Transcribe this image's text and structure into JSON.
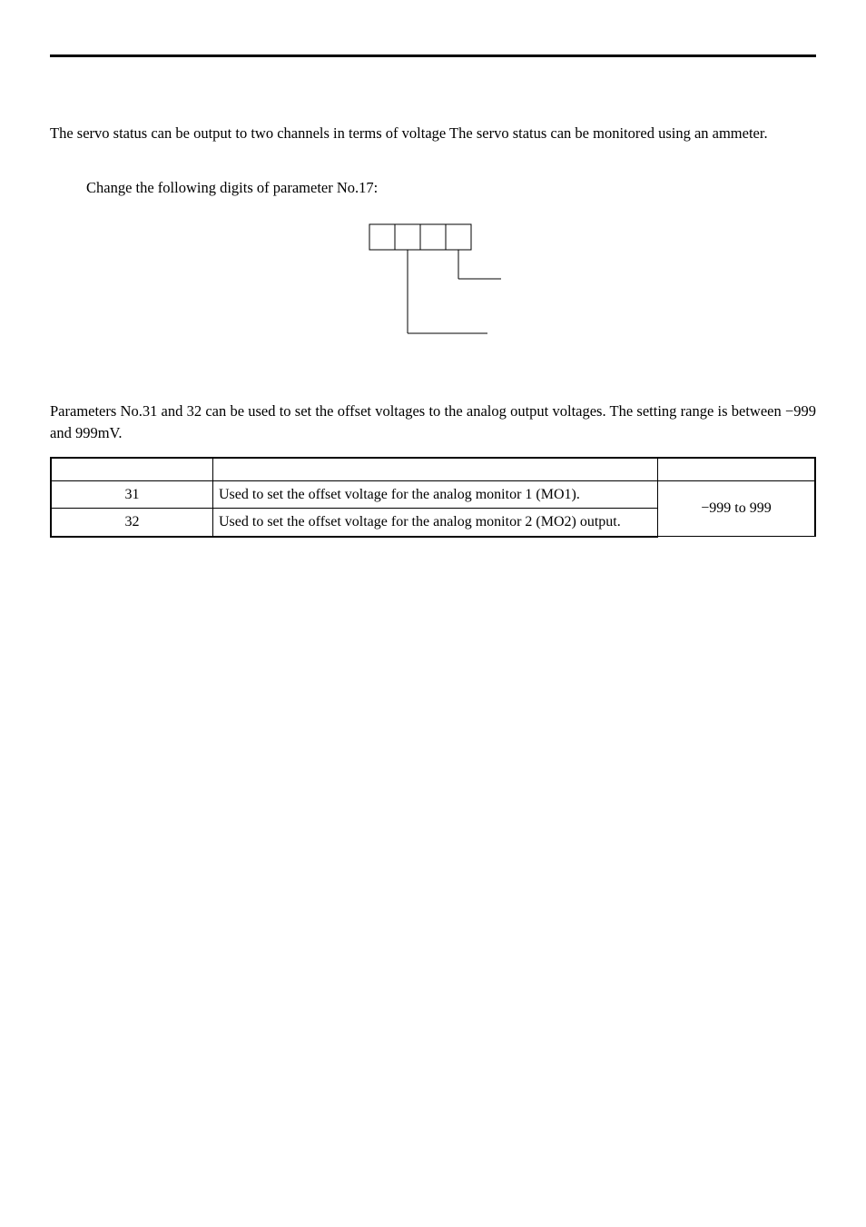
{
  "para1": "The servo status can be output to two channels in terms of voltage  The servo status can be monitored using an ammeter.",
  "para2": "Change the following digits of parameter No.17:",
  "para3": "Parameters No.31 and 32 can be used to set the offset voltages to the analog output voltages. The setting range is between −999 and 999mV.",
  "table": {
    "headers": [
      "",
      "",
      ""
    ],
    "rows": [
      {
        "no": "31",
        "desc": "Used to set the offset voltage for the analog monitor 1 (MO1)."
      },
      {
        "no": "32",
        "desc": "Used to set the offset voltage for the analog monitor 2 (MO2) output."
      }
    ],
    "range": "−999 to 999"
  }
}
